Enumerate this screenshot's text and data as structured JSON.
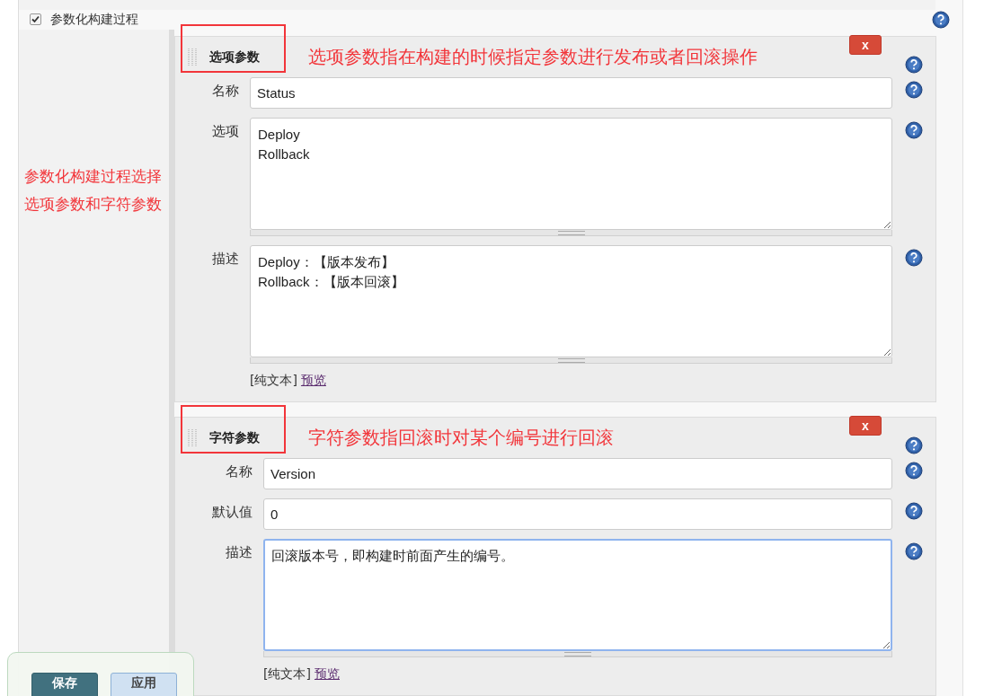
{
  "parameterized": {
    "label": "参数化构建过程",
    "checked": true
  },
  "side_note": [
    "参数化构建过程选择",
    "选项参数和字符参数"
  ],
  "parameters": [
    {
      "kind": "choice",
      "title": "选项参数",
      "annotation": "选项参数指在构建的时候指定参数进行发布或者回滚操作",
      "delete": "x",
      "fields": [
        {
          "kind": "text",
          "label": "名称",
          "value": "Status"
        },
        {
          "kind": "textarea",
          "label": "选项",
          "value": "Deploy\nRollback",
          "focused": false
        },
        {
          "kind": "textarea",
          "label": "描述",
          "value": "Deploy：【版本发布】\nRollback：【版本回滚】",
          "focused": false
        }
      ],
      "format": "[纯文本]",
      "preview": "预览"
    },
    {
      "kind": "string",
      "title": "字符参数",
      "annotation": "字符参数指回滚时对某个编号进行回滚",
      "delete": "x",
      "fields": [
        {
          "kind": "text",
          "label": "名称",
          "value": "Version"
        },
        {
          "kind": "text",
          "label": "默认值",
          "value": "0"
        },
        {
          "kind": "textarea",
          "label": "描述",
          "value": "回滚版本号，即构建时前面产生的编号。",
          "focused": true
        }
      ],
      "format": "[纯文本]",
      "preview": "预览"
    }
  ],
  "buttons": [
    {
      "kind": "primary",
      "label": "保存"
    },
    {
      "kind": "secondary",
      "label": "应用"
    }
  ]
}
